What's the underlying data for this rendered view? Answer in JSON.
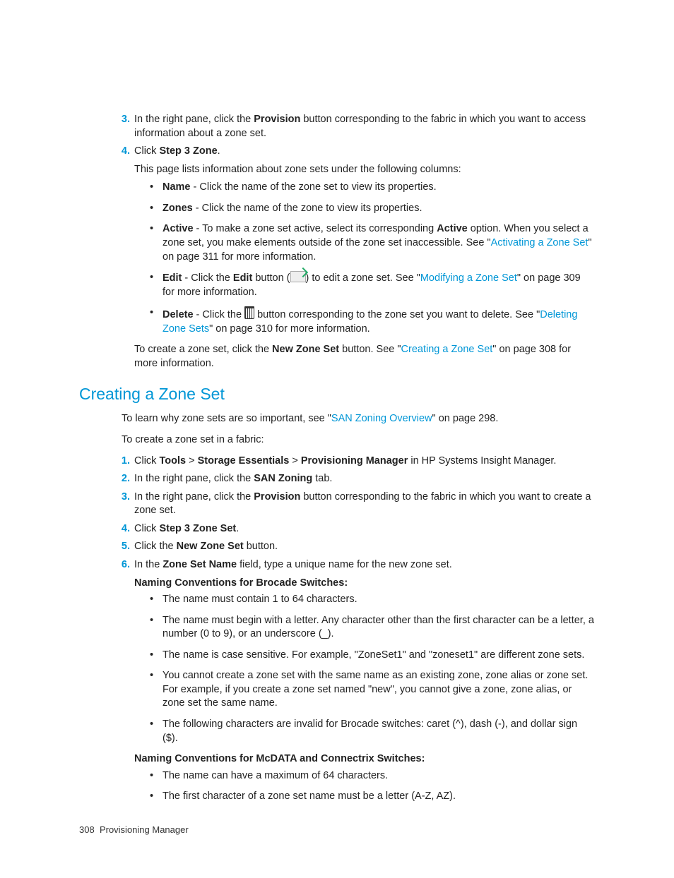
{
  "step3": {
    "num": "3.",
    "text_a": "In the right pane, click the ",
    "bold": "Provision",
    "text_b": " button corresponding to the fabric in which you want to access information about a zone set."
  },
  "step4": {
    "num": "4.",
    "text_a": "Click ",
    "bold": "Step 3 Zone",
    "text_b": ".",
    "desc": "This page lists information about zone sets under the following columns:",
    "bullets": {
      "name": {
        "label": "Name",
        "rest": " - Click the name of the zone set to view its properties."
      },
      "zones": {
        "label": "Zones",
        "rest": " - Click the name of the zone to view its properties."
      },
      "active": {
        "label": "Active",
        "a": " - To make a zone set active, select its corresponding ",
        "bold": "Active",
        "b": " option. When you select a zone set, you make elements outside of the zone set inaccessible. See \"",
        "link": "Activating a Zone Set",
        "c": "\" on page 311 for more information."
      },
      "edit": {
        "label": "Edit",
        "a": " - Click the ",
        "bold": "Edit",
        "b": " button (",
        "c": ") to edit a zone set. See \"",
        "link": "Modifying a Zone Set",
        "d": "\" on page 309 for more information."
      },
      "delete": {
        "label": "Delete",
        "a": " - Click the ",
        "b": " button corresponding to the zone set you want to delete. See \"",
        "link": "Deleting Zone Sets",
        "c": "\" on page 310 for more information."
      }
    },
    "closing": {
      "a": "To create a zone set, click the ",
      "bold": "New Zone Set",
      "b": " button. See \"",
      "link": "Creating a Zone Set",
      "c": "\" on page 308 for more information."
    }
  },
  "h2": "Creating a Zone Set",
  "intro1": {
    "a": "To learn why zone sets are so important, see \"",
    "link": "SAN Zoning Overview",
    "b": "\" on page 298."
  },
  "intro2": "To create a zone set in a fabric:",
  "steps2": {
    "s1": {
      "num": "1.",
      "a": "Click ",
      "b1": "Tools",
      "gt1": " > ",
      "b2": "Storage Essentials",
      "gt2": " > ",
      "b3": "Provisioning Manager",
      "c": " in HP Systems Insight Manager."
    },
    "s2": {
      "num": "2.",
      "a": "In the right pane, click the ",
      "bold": "SAN Zoning",
      "b": " tab."
    },
    "s3": {
      "num": "3.",
      "a": "In the right pane, click the ",
      "bold": "Provision",
      "b": " button corresponding to the fabric in which you want to create a zone set."
    },
    "s4": {
      "num": "4.",
      "a": "Click ",
      "bold": "Step 3 Zone Set",
      "b": "."
    },
    "s5": {
      "num": "5.",
      "a": "Click the ",
      "bold": "New Zone Set",
      "b": " button."
    },
    "s6": {
      "num": "6.",
      "a": "In the ",
      "bold": "Zone Set Name",
      "b": " field, type a unique name for the new zone set."
    }
  },
  "brocade": {
    "heading": "Naming Conventions for Brocade Switches",
    "b1": "The name must contain 1 to 64 characters.",
    "b2": "The name must begin with a letter. Any character other than the first character can be a letter, a number (0 to 9), or an underscore (_).",
    "b3": "The name is case sensitive. For example, \"ZoneSet1\" and \"zoneset1\" are different zone sets.",
    "b4": "You cannot create a zone set with the same name as an existing zone, zone alias or zone set. For example, if you create a zone set named \"new\", you cannot give a zone, zone alias, or zone set the same name.",
    "b5": "The following characters are invalid for Brocade switches: caret (^), dash (-), and dollar sign ($)."
  },
  "mcdata": {
    "heading": "Naming Conventions for McDATA and Connectrix Switches",
    "b1": "The name can have a maximum of 64 characters.",
    "b2": "The first character of a zone set name must be a letter (A-Z, AZ)."
  },
  "footer": {
    "page": "308",
    "title": "Provisioning Manager"
  }
}
